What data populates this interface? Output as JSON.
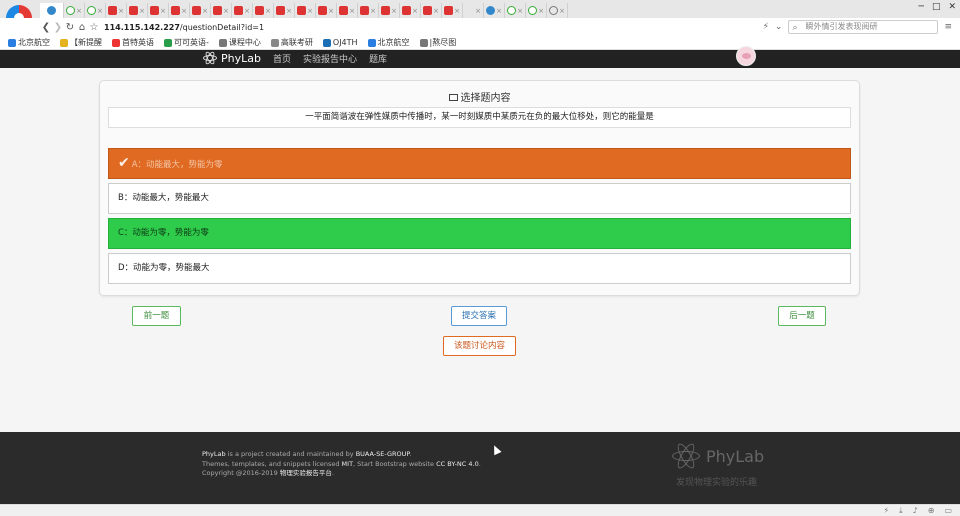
{
  "browser": {
    "tabs": [
      {
        "icon": "rainbow",
        "label": "",
        "active": true
      },
      {
        "icon": "green",
        "label": "×"
      },
      {
        "icon": "green",
        "label": "×"
      },
      {
        "icon": "red",
        "label": "×"
      },
      {
        "icon": "red",
        "label": "×"
      },
      {
        "icon": "red",
        "label": "×"
      },
      {
        "icon": "red",
        "label": "×"
      },
      {
        "icon": "red",
        "label": "×"
      },
      {
        "icon": "red",
        "label": "×"
      },
      {
        "icon": "red",
        "label": "×"
      },
      {
        "icon": "red",
        "label": "×"
      },
      {
        "icon": "red",
        "label": "×"
      },
      {
        "icon": "red",
        "label": "×"
      },
      {
        "icon": "red",
        "label": "×"
      },
      {
        "icon": "red",
        "label": "×"
      },
      {
        "icon": "red",
        "label": "×"
      },
      {
        "icon": "red",
        "label": "×"
      },
      {
        "icon": "red",
        "label": "×"
      },
      {
        "icon": "red",
        "label": "×"
      },
      {
        "icon": "red",
        "label": "×"
      },
      {
        "icon": "plain",
        "label": "×"
      },
      {
        "icon": "blue",
        "label": "×"
      },
      {
        "icon": "green",
        "label": "×"
      },
      {
        "icon": "green",
        "label": "×"
      },
      {
        "icon": "grey",
        "label": "×"
      }
    ],
    "url_host": "114.115.142.227",
    "url_path": "/questionDetail?id=1",
    "search_placeholder": "瞬外情引发表现阅研",
    "bookmarks": [
      "北京航空",
      "【新提醒",
      "首特英语",
      "可可英语-",
      "课程中心",
      "高联考研",
      "OJ4TH",
      "北京航空",
      "|熬尽图"
    ]
  },
  "navbar": {
    "brand": "PhyLab",
    "links": [
      "首页",
      "实验报告中心",
      "题库"
    ]
  },
  "question_card": {
    "title": "选择题内容",
    "question": "一平面简谐波在弹性媒质中传播时，某一时刻媒质中某质元在负的最大位移处，则它的能量是",
    "options": [
      {
        "label": "A：动能最大，势能为零",
        "state": "selected-wrong"
      },
      {
        "label": "B：动能最大，势能最大",
        "state": "normal"
      },
      {
        "label": "C：动能为零，势能为零",
        "state": "correct"
      },
      {
        "label": "D：动能为零，势能最大",
        "state": "normal"
      }
    ]
  },
  "actions": {
    "prev": "前一题",
    "submit": "提交答案",
    "next": "后一题",
    "discuss": "该题讨论内容"
  },
  "footer": {
    "line1_brand": "PhyLab",
    "line1_mid": " is a project created and maintained by ",
    "line1_group": "BUAA-SE-GROUP",
    "line1_end": ".",
    "line2_start": "Themes, templates, and snippets licensed ",
    "line2_mit": "MIT",
    "line2_mid": ", Start Bootstrap website ",
    "line2_cc": "CC BY-NC 4.0",
    "line2_end": ".",
    "line3_start": "Copyright @2016-2019 ",
    "line3_site": "物理实验报告平台",
    "line3_end": ".",
    "logo_text": "PhyLab",
    "slogan": "发现物理实验的乐趣"
  },
  "colors": {
    "wrong_selected": "#e06a22",
    "correct": "#2ecc4a",
    "navbar": "#222222",
    "footer": "#2b2b2b"
  }
}
